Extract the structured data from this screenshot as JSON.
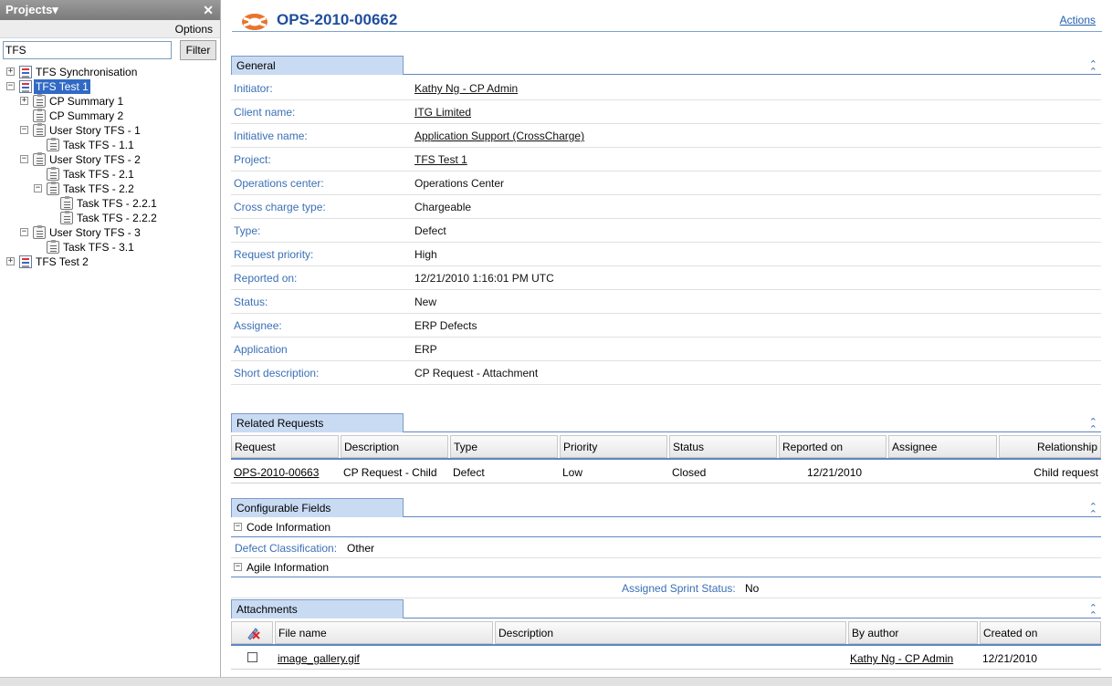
{
  "left_panel": {
    "title": "Projects▾",
    "close_symbol": "✕",
    "options_label": "Options",
    "search_value": "TFS",
    "filter_label": "Filter",
    "tree": [
      {
        "label": "TFS Synchronisation",
        "icon": "project-icon",
        "expander": "+"
      },
      {
        "label": "TFS Test 1",
        "icon": "project-icon",
        "expander": "−",
        "selected": true
      },
      {
        "label": "CP Summary 1",
        "icon": "clipboard-icon",
        "expander": "+"
      },
      {
        "label": "CP Summary 2",
        "icon": "clipboard-edit-icon",
        "expander": ""
      },
      {
        "label": "User Story TFS - 1",
        "icon": "clipboard-edit-icon",
        "expander": "−"
      },
      {
        "label": "Task TFS - 1.1",
        "icon": "clipboard-edit-icon",
        "expander": ""
      },
      {
        "label": "User Story TFS - 2",
        "icon": "clipboard-icon",
        "expander": "−"
      },
      {
        "label": "Task TFS - 2.1",
        "icon": "clipboard-icon",
        "expander": ""
      },
      {
        "label": "Task TFS - 2.2",
        "icon": "clipboard-icon",
        "expander": "−"
      },
      {
        "label": "Task TFS - 2.2.1",
        "icon": "clipboard-icon",
        "expander": ""
      },
      {
        "label": "Task TFS - 2.2.2",
        "icon": "clipboard-edit-icon",
        "expander": ""
      },
      {
        "label": "User Story TFS - 3",
        "icon": "clipboard-icon",
        "expander": "−"
      },
      {
        "label": "Task TFS - 3.1",
        "icon": "clipboard-icon",
        "expander": ""
      },
      {
        "label": "TFS Test 2",
        "icon": "project-icon",
        "expander": "+"
      }
    ]
  },
  "header": {
    "request_id": "OPS-2010-00662",
    "actions_label": "Actions"
  },
  "general": {
    "section_title": "General",
    "collapse_symbol": "⌃",
    "rows": [
      {
        "key": "Initiator:",
        "value": "Kathy Ng - CP Admin",
        "link": true
      },
      {
        "key": "Client name:",
        "value": "ITG Limited",
        "link": true
      },
      {
        "key": "Initiative name:",
        "value": "Application Support (CrossCharge)",
        "link": true
      },
      {
        "key": "Project:",
        "value": "TFS Test 1",
        "link": true
      },
      {
        "key": "Operations center:",
        "value": "Operations Center",
        "link": false
      },
      {
        "key": "Cross charge type:",
        "value": "Chargeable",
        "link": false
      },
      {
        "key": "Type:",
        "value": "Defect",
        "link": false
      },
      {
        "key": "Request priority:",
        "value": "High",
        "link": false
      },
      {
        "key": "Reported on:",
        "value": "12/21/2010 1:16:01 PM UTC",
        "link": false
      },
      {
        "key": "Status:",
        "value": "New",
        "link": false
      },
      {
        "key": "Assignee:",
        "value": "ERP Defects",
        "link": false
      },
      {
        "key": "Application",
        "value": "ERP",
        "link": false
      },
      {
        "key": "Short description:",
        "value": "CP Request - Attachment",
        "link": false
      }
    ]
  },
  "related": {
    "section_title": "Related Requests",
    "columns": [
      "Request",
      "Description",
      "Type",
      "Priority",
      "Status",
      "Reported on",
      "Assignee",
      "Relationship"
    ],
    "rows": [
      {
        "request": "OPS-2010-00663",
        "description": "CP Request - Child",
        "type": "Defect",
        "priority": "Low",
        "status": "Closed",
        "reported_on": "12/21/2010",
        "assignee": "",
        "relationship": "Child request"
      }
    ]
  },
  "configurable": {
    "section_title": "Configurable Fields",
    "code_info_label": "Code Information",
    "defect_classification_key": "Defect Classification:",
    "defect_classification_value": "Other",
    "agile_info_label": "Agile Information",
    "sprint_status_key": "Assigned Sprint Status:",
    "sprint_status_value": "No"
  },
  "attachments": {
    "section_title": "Attachments",
    "columns": [
      "File name",
      "Description",
      "By author",
      "Created on"
    ],
    "rows": [
      {
        "file_name": "image_gallery.gif",
        "description": "",
        "author": "Kathy Ng - CP Admin",
        "created_on": "12/21/2010"
      }
    ]
  },
  "colors": {
    "accent_blue": "#1f4e9c",
    "label_blue": "#3a6fb5",
    "section_tab": "#c9dbf3",
    "selection": "#316ac5"
  }
}
